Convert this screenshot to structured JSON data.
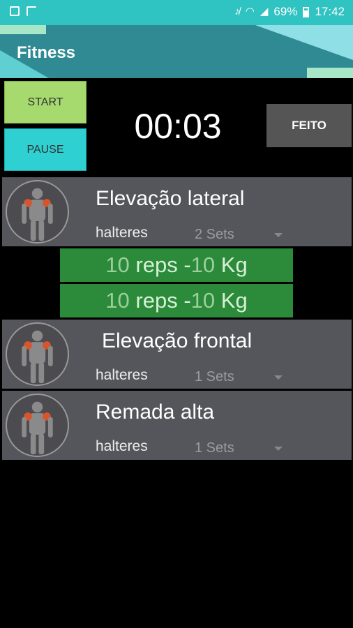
{
  "status": {
    "battery": "69%",
    "time": "17:42",
    "icons": [
      "image-icon",
      "flipboard-icon",
      "mute-icon",
      "wifi-icon",
      "signal-icon",
      "battery-icon"
    ]
  },
  "app": {
    "title": "Fitness"
  },
  "controls": {
    "start_label": "START",
    "pause_label": "PAUSE",
    "timer": "00:03",
    "done_label": "FEITO"
  },
  "exercises": [
    {
      "name": "Elevação lateral",
      "equipment": "halteres",
      "sets": "2 Sets",
      "icon": "shoulder-muscle-icon"
    },
    {
      "name": "Elevação frontal",
      "equipment": "halteres",
      "sets": "1 Sets",
      "icon": "shoulder-muscle-icon"
    },
    {
      "name": "Remada alta",
      "equipment": "halteres",
      "sets": "1 Sets",
      "icon": "shoulder-muscle-icon"
    }
  ],
  "sets": [
    {
      "reps": "10",
      "reps_label": "reps - ",
      "weight": "10",
      "unit": "Kg"
    },
    {
      "reps": "10",
      "reps_label": "reps - ",
      "weight": "10",
      "unit": "Kg"
    }
  ],
  "colors": {
    "status_bar": "#2fc3c1",
    "app_bar": "#2f8a93",
    "start": "#a6d96e",
    "pause": "#2fd0d2",
    "set_row": "#2b8b3a",
    "card": "#55555c"
  }
}
